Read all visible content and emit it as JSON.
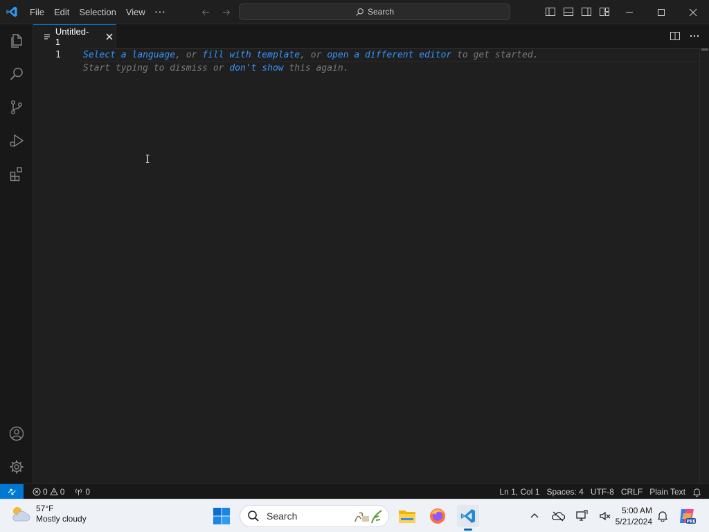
{
  "titlebar": {
    "menu": [
      "File",
      "Edit",
      "Selection",
      "View"
    ],
    "more": "···",
    "search_label": "Search"
  },
  "tab": {
    "label": "Untitled-1"
  },
  "editor": {
    "line_number": "1",
    "hint_line1": {
      "select_language": "Select a language",
      "sep1": ", or ",
      "fill_template": "fill with template",
      "sep2": ", or ",
      "open_editor": "open a different editor",
      "tail": " to get started."
    },
    "hint_line2": {
      "lead": "Start typing to dismiss or ",
      "dont_show": "don't show",
      "tail": " this again."
    }
  },
  "statusbar": {
    "errors": "0",
    "warnings": "0",
    "ports": "0",
    "position": "Ln 1, Col 1",
    "spaces": "Spaces: 4",
    "encoding": "UTF-8",
    "eol": "CRLF",
    "language": "Plain Text"
  },
  "taskbar": {
    "weather_temp": "57°F",
    "weather_cond": "Mostly cloudy",
    "search_placeholder": "Search",
    "time": "5:00 AM",
    "date": "5/21/2024"
  },
  "colors": {
    "accent": "#0078d4",
    "link": "#3794ff",
    "editor_bg": "#1f1f1f"
  }
}
